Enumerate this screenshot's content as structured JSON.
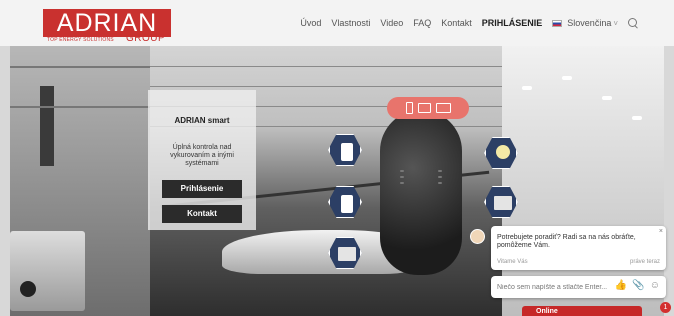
{
  "header": {
    "logo_text": "ADRIAN",
    "logo_tagline": "TOP ENERGY SOLUTIONS",
    "logo_group": "GROUP",
    "nav": [
      {
        "label": "Úvod"
      },
      {
        "label": "Vlastnosti"
      },
      {
        "label": "Video"
      },
      {
        "label": "FAQ"
      },
      {
        "label": "Kontakt"
      },
      {
        "label": "PRIHLÁSENIE"
      }
    ],
    "language": "Slovenčina",
    "language_chevron": "˅"
  },
  "side_card": {
    "title": "ADRIAN smart",
    "description": "Úplná kontrola nad vykurovaním a inými systémami",
    "login_button": "Prihlásenie",
    "contact_button": "Kontakt"
  },
  "device_switcher": {
    "icons": [
      "phone-icon",
      "tablet-icon",
      "monitor-icon"
    ]
  },
  "feature_icons": [
    "thermostat-icon",
    "light-bulb-icon",
    "boiler-icon",
    "fireplace-icon",
    "control-panel-icon",
    "screen-icon"
  ],
  "chat": {
    "message": "Potrebujete poradiť? Radi sa na nás obráťte, pomôžeme Vám.",
    "sender": "Vitame Vás",
    "time": "práve teraz",
    "close_glyph": "×",
    "input_placeholder": "Niečo sem napíšte a stlačte Enter...",
    "tools": [
      "thumb-up-icon",
      "attachment-icon",
      "emoji-icon"
    ],
    "tool_glyphs": [
      "👍",
      "📎",
      "☺"
    ],
    "online_label": "Online",
    "badge_count": "1"
  },
  "colors": {
    "brand_red": "#c9312f",
    "hex_blue": "#2c3f65",
    "pill_coral": "#e8746c",
    "dark_button": "#2b2b2b"
  }
}
